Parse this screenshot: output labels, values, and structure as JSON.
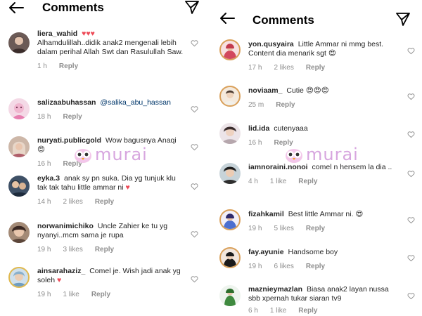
{
  "left": {
    "title": "Comments",
    "comments": [
      {
        "user": "liera_wahid",
        "pre": "",
        "mention": "",
        "text": "Alhamdulillah..didik anak2 mengenali lebih dalam perihal Allah Swt dan Rasulullah Saw.",
        "emoji": "",
        "head_emoji": "♥♥♥",
        "time": "1 h",
        "likes": "",
        "reply": "Reply"
      },
      {
        "user": "salizaabuhassan",
        "pre": "",
        "mention": "@salika_abu_hassan",
        "text": "",
        "emoji": "",
        "head_emoji": "",
        "time": "18 h",
        "likes": "",
        "reply": "Reply"
      },
      {
        "user": "nuryati.publicgold",
        "pre": "",
        "mention": "",
        "text": "Wow bagusnya Anaqi",
        "emoji": "😍",
        "head_emoji": "",
        "time": "16 h",
        "likes": "",
        "reply": "Reply"
      },
      {
        "user": "eyka.3",
        "pre": "",
        "mention": "",
        "text": "anak sy pn suka. Dia yg tunjuk klu tak tak tahu little ammar ni",
        "emoji": "♥",
        "head_emoji": "",
        "time": "14 h",
        "likes": "2 likes",
        "reply": "Reply"
      },
      {
        "user": "norwanimichiko",
        "pre": "",
        "mention": "",
        "text": "Uncle Zahier ke tu yg nyanyi..mcm sama je rupa",
        "emoji": "",
        "head_emoji": "",
        "time": "19 h",
        "likes": "3 likes",
        "reply": "Reply"
      },
      {
        "user": "ainsarahaziz_",
        "pre": "",
        "mention": "",
        "text": "Comel je. Wish jadi anak yg soleh",
        "emoji": "♥",
        "head_emoji": "",
        "time": "19 h",
        "likes": "1 like",
        "reply": "Reply"
      }
    ]
  },
  "right": {
    "title": "Comments",
    "comments": [
      {
        "user": "yon.qusyaira",
        "text": "Little Ammar ni mmg best. Content dia menarik sgt",
        "emoji": "😍",
        "time": "17 h",
        "likes": "2 likes",
        "reply": "Reply"
      },
      {
        "user": "noviaam_",
        "text": "Cutie",
        "emoji": "😍😍😍",
        "time": "25 m",
        "likes": "",
        "reply": "Reply"
      },
      {
        "user": "lid.ida",
        "text": "cutenyaaa",
        "emoji": "",
        "time": "16 h",
        "likes": "",
        "reply": "Reply"
      },
      {
        "user": "iamnoraini.nonoi",
        "text": "comel n hensem la dia ..",
        "emoji": "",
        "time": "4 h",
        "likes": "1 like",
        "reply": "Reply"
      },
      {
        "user": "fizahkamil",
        "text": "Best little Ammar ni.",
        "emoji": "😍",
        "time": "19 h",
        "likes": "5 likes",
        "reply": "Reply"
      },
      {
        "user": "fay.ayunie",
        "text": "Handsome boy",
        "emoji": "",
        "time": "19 h",
        "likes": "6 likes",
        "reply": "Reply"
      },
      {
        "user": "maznieymazlan",
        "text": "Biasa anak2 layan nussa sbb xpernah tukar siaran tv9",
        "emoji": "",
        "time": "6 h",
        "likes": "1 like",
        "reply": "Reply"
      }
    ]
  },
  "watermark": {
    "text": "murai"
  },
  "icons": {
    "back": "arrow-left-icon",
    "send": "paper-plane-icon",
    "like": "heart-outline-icon"
  },
  "colors": {
    "text": "#262626",
    "secondary": "#8e8e8e",
    "mention": "#00376b",
    "heart": "#ed4956",
    "watermark": "#d7a6df"
  }
}
